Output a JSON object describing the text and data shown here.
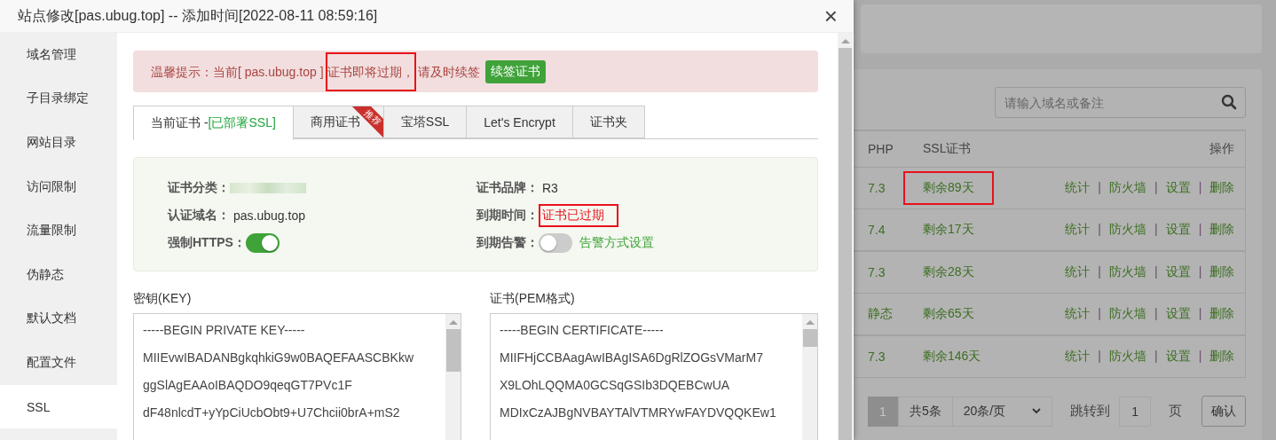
{
  "dialog": {
    "title": "站点修改[pas.ubug.top] -- 添加时间[2022-08-11 08:59:16]",
    "close": "×"
  },
  "sidebar": {
    "items": [
      {
        "label": "域名管理",
        "selected": false
      },
      {
        "label": "子目录绑定",
        "selected": false
      },
      {
        "label": "网站目录",
        "selected": false
      },
      {
        "label": "访问限制",
        "selected": false
      },
      {
        "label": "流量限制",
        "selected": false
      },
      {
        "label": "伪静态",
        "selected": false
      },
      {
        "label": "默认文档",
        "selected": false
      },
      {
        "label": "配置文件",
        "selected": false
      },
      {
        "label": "SSL",
        "selected": true
      }
    ]
  },
  "alert": {
    "parts": [
      {
        "text": "温馨提示：当前[ pas.ubug.top ]",
        "highlighted": false
      },
      {
        "text": "证书即将过期，",
        "highlighted": true
      },
      {
        "text": "请及时续签",
        "highlighted": false
      }
    ],
    "button": "续签证书"
  },
  "tabs": [
    {
      "label": "当前证书 - ",
      "status": "[已部署SSL]",
      "selected": true
    },
    {
      "label": "商用证书",
      "ribbon": "推荐",
      "selected": false
    },
    {
      "label": "宝塔SSL",
      "selected": false
    },
    {
      "label": "Let's Encrypt",
      "selected": false
    },
    {
      "label": "证书夹",
      "selected": false
    }
  ],
  "cert_info": {
    "fields": [
      {
        "kind": "blurred",
        "label": "证书分类："
      },
      {
        "kind": "text",
        "label": "证书品牌：",
        "value": "R3",
        "expired": false,
        "highlighted": false
      },
      {
        "kind": "text",
        "label": "认证域名：",
        "value": "pas.ubug.top",
        "expired": false,
        "highlighted": false
      },
      {
        "kind": "text",
        "label": "到期时间：",
        "value": "证书已过期",
        "expired": true,
        "highlighted": true
      },
      {
        "kind": "toggle",
        "label": "强制HTTPS：",
        "on": true
      },
      {
        "kind": "toggle",
        "label": "到期告警：",
        "on": false,
        "link": "告警方式设置"
      }
    ]
  },
  "key": {
    "label": "密钥(KEY)",
    "lines": [
      "-----BEGIN PRIVATE KEY-----",
      "MIIEvwIBADANBgkqhkiG9w0BAQEFAASCBKkw",
      "ggSlAgEAAoIBAQDO9qeqGT7PVc1F",
      "dF48nlcdT+yYpCiUcbObt9+U7Chcii0brA+mS2"
    ]
  },
  "certificate": {
    "label": "证书(PEM格式)",
    "lines": [
      "-----BEGIN CERTIFICATE-----",
      "MIIFHjCCBAagAwIBAgISA6DgRlZOGsVMarM7",
      "X9LOhLQQMA0GCSqGSIb3DQEBCwUA",
      "MDIxCzAJBgNVBAYTAlVTMRYwFAYDVQQKEw1"
    ]
  },
  "site_list": {
    "search": {
      "placeholder": "请输入域名或备注"
    },
    "columns": [
      "PHP",
      "SSL证书",
      "操作"
    ],
    "separator": "|",
    "rows": [
      {
        "php": "7.3",
        "ssl": "剩余89天",
        "highlighted": true,
        "actions": [
          "统计",
          "防火墙",
          "设置",
          "删除"
        ]
      },
      {
        "php": "7.4",
        "ssl": "剩余17天",
        "highlighted": false,
        "actions": [
          "统计",
          "防火墙",
          "设置",
          "删除"
        ]
      },
      {
        "php": "7.3",
        "ssl": "剩余28天",
        "highlighted": false,
        "actions": [
          "统计",
          "防火墙",
          "设置",
          "删除"
        ]
      },
      {
        "php": "静态",
        "ssl": "剩余65天",
        "highlighted": false,
        "actions": [
          "统计",
          "防火墙",
          "设置",
          "删除"
        ]
      },
      {
        "php": "7.3",
        "ssl": "剩余146天",
        "highlighted": false,
        "actions": [
          "统计",
          "防火墙",
          "设置",
          "删除"
        ]
      }
    ],
    "pagination": {
      "current": "1",
      "total": "共5条",
      "page_size": "20条/页",
      "jump_label": "跳转到",
      "jump_value": "1",
      "page_unit": "页",
      "confirm": "确认"
    }
  }
}
